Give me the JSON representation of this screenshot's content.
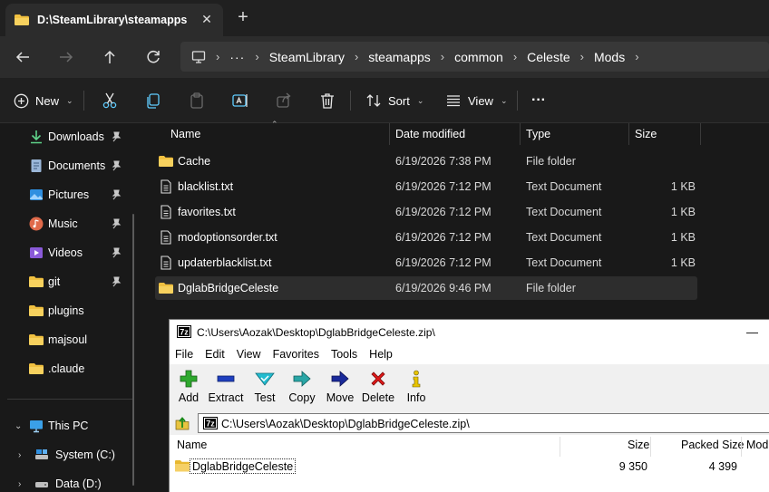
{
  "tab": {
    "title": "D:\\SteamLibrary\\steamapps\\c",
    "close": "✕",
    "new": "+"
  },
  "breadcrumb": [
    "SteamLibrary",
    "steamapps",
    "common",
    "Celeste",
    "Mods"
  ],
  "breadcrumb_more": "···",
  "commands": {
    "new": "New",
    "sort": "Sort",
    "view": "View",
    "more": "···"
  },
  "nav": {
    "quick": [
      {
        "label": "Downloads",
        "icon": "download-icon"
      },
      {
        "label": "Documents",
        "icon": "document-icon"
      },
      {
        "label": "Pictures",
        "icon": "pictures-icon"
      },
      {
        "label": "Music",
        "icon": "music-icon"
      },
      {
        "label": "Videos",
        "icon": "video-icon"
      },
      {
        "label": "git",
        "icon": "folder-icon"
      },
      {
        "label": "plugins",
        "icon": "folder-icon"
      },
      {
        "label": "majsoul",
        "icon": "folder-icon"
      },
      {
        "label": ".claude",
        "icon": "folder-icon"
      }
    ],
    "this_pc": "This PC",
    "drives": [
      "System (C:)",
      "Data (D:)"
    ]
  },
  "columns": {
    "name": "Name",
    "date": "Date modified",
    "type": "Type",
    "size": "Size"
  },
  "files": [
    {
      "name": "Cache",
      "date": "6/19/2026 7:38 PM",
      "type": "File folder",
      "size": "",
      "kind": "folder"
    },
    {
      "name": "blacklist.txt",
      "date": "6/19/2026 7:12 PM",
      "type": "Text Document",
      "size": "1 KB",
      "kind": "text"
    },
    {
      "name": "favorites.txt",
      "date": "6/19/2026 7:12 PM",
      "type": "Text Document",
      "size": "1 KB",
      "kind": "text"
    },
    {
      "name": "modoptionsorder.txt",
      "date": "6/19/2026 7:12 PM",
      "type": "Text Document",
      "size": "1 KB",
      "kind": "text"
    },
    {
      "name": "updaterblacklist.txt",
      "date": "6/19/2026 7:12 PM",
      "type": "Text Document",
      "size": "1 KB",
      "kind": "text"
    },
    {
      "name": "DglabBridgeCeleste",
      "date": "6/19/2026 9:46 PM",
      "type": "File folder",
      "size": "",
      "kind": "folder",
      "selected": true
    }
  ],
  "zip": {
    "title": "C:\\Users\\Aozak\\Desktop\\DglabBridgeCeleste.zip\\",
    "minimize": "—",
    "menu": [
      "File",
      "Edit",
      "View",
      "Favorites",
      "Tools",
      "Help"
    ],
    "tools": [
      "Add",
      "Extract",
      "Test",
      "Copy",
      "Move",
      "Delete",
      "Info"
    ],
    "path": "C:\\Users\\Aozak\\Desktop\\DglabBridgeCeleste.zip\\",
    "columns": {
      "name": "Name",
      "size": "Size",
      "packed": "Packed Size",
      "modified": "Mod"
    },
    "rows": [
      {
        "name": "DglabBridgeCeleste",
        "size": "9 350",
        "packed": "4 399"
      }
    ]
  },
  "colors": {
    "folder": "#f0c040",
    "accent": "#60cdff",
    "window_bg": "#191919"
  }
}
